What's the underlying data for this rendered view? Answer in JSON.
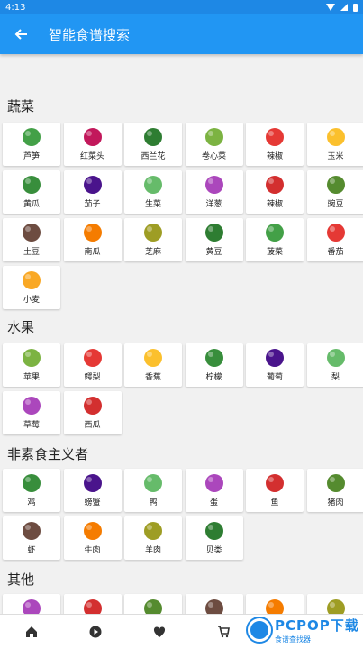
{
  "status": {
    "time": "4:13"
  },
  "appbar": {
    "title": "智能食谱搜索"
  },
  "sections": [
    {
      "title": "蔬菜",
      "items": [
        "芦笋",
        "红菜头",
        "西兰花",
        "卷心菜",
        "辣椒",
        "玉米",
        "黄瓜",
        "茄子",
        "生菜",
        "洋葱",
        "辣椒",
        "豌豆",
        "土豆",
        "南瓜",
        "芝麻",
        "黄豆",
        "菠菜",
        "番茄",
        "小麦"
      ]
    },
    {
      "title": "水果",
      "items": [
        "苹果",
        "鳄梨",
        "香蕉",
        "柠檬",
        "葡萄",
        "梨",
        "草莓",
        "西瓜"
      ]
    },
    {
      "title": "非素食主义者",
      "items": [
        "鸡",
        "螃蟹",
        "鸭",
        "蛋",
        "鱼",
        "猪肉",
        "虾",
        "牛肉",
        "羊肉",
        "贝类"
      ]
    },
    {
      "title": "其他",
      "items": [
        "",
        "",
        "",
        "",
        "",
        ""
      ]
    }
  ],
  "bottom_nav": [
    "home-icon",
    "play-icon",
    "heart-icon",
    "cart-icon"
  ],
  "watermark": {
    "main": "PCPOP下载",
    "sub": "食谱查找器"
  }
}
